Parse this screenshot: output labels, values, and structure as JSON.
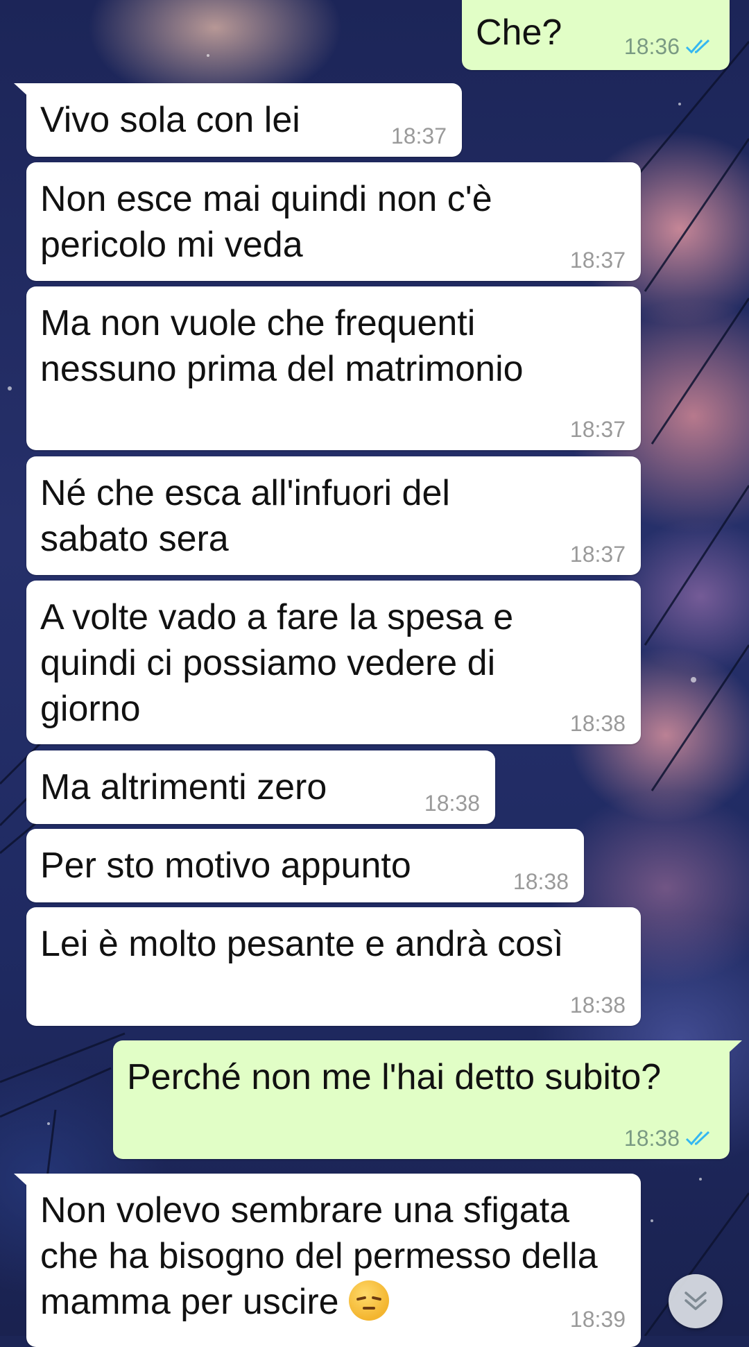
{
  "colors": {
    "incoming_bubble": "#ffffff",
    "outgoing_bubble": "#e1fec6",
    "read_tick": "#34b7f1",
    "timestamp": "#9a9a9a"
  },
  "messages": [
    {
      "direction": "out",
      "text": "Che?",
      "time": "18:36",
      "status": "read-double-tick-icon"
    },
    {
      "direction": "in",
      "text": "Vivo sola con lei",
      "time": "18:37"
    },
    {
      "direction": "in",
      "text": "Non esce mai quindi non c'è pericolo mi veda",
      "time": "18:37"
    },
    {
      "direction": "in",
      "text": "Ma non vuole che frequenti nessuno prima del matrimonio",
      "time": "18:37"
    },
    {
      "direction": "in",
      "text": "Né che esca all'infuori del sabato sera",
      "time": "18:37"
    },
    {
      "direction": "in",
      "text": "A volte vado a fare la spesa e quindi ci possiamo vedere di giorno",
      "time": "18:38"
    },
    {
      "direction": "in",
      "text": "Ma altrimenti zero",
      "time": "18:38"
    },
    {
      "direction": "in",
      "text": "Per sto motivo appunto",
      "time": "18:38"
    },
    {
      "direction": "in",
      "text": "Lei è molto pesante e andrà così",
      "time": "18:38"
    },
    {
      "direction": "out",
      "text": "Perché non me l'hai detto subito?",
      "time": "18:38",
      "status": "read-double-tick-icon"
    },
    {
      "direction": "in",
      "text": "Non volevo sembrare una sfigata che ha bisogno del permesso della mamma per uscire",
      "time": "18:39",
      "emoji": "pensive-face-emoji"
    }
  ],
  "scroll_button": {
    "icon": "chevron-double-down-icon"
  }
}
